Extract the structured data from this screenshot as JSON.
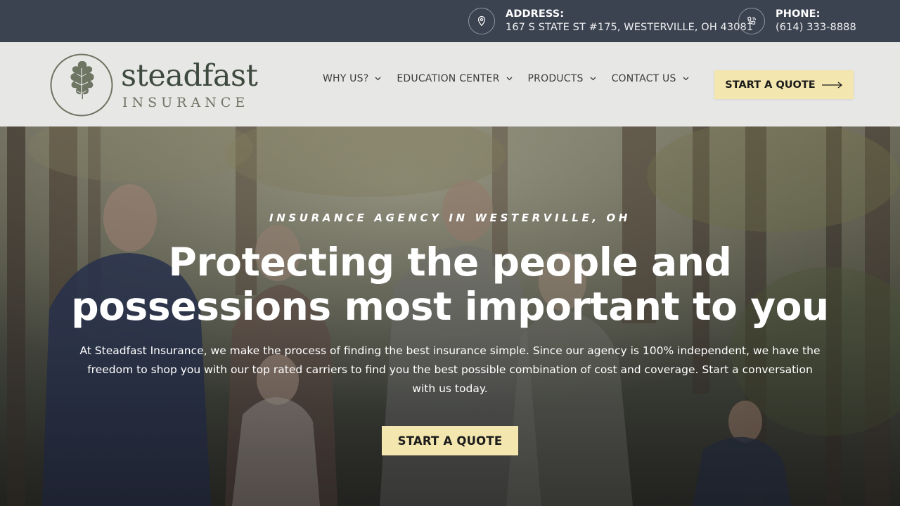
{
  "topbar": {
    "address": {
      "label": "ADDRESS:",
      "value": "167 S STATE ST #175, WESTERVILLE, OH 43081",
      "icon": "map-pin-icon"
    },
    "phone": {
      "label": "PHONE:",
      "value": "(614) 333-8888",
      "icon": "phone-icon"
    }
  },
  "logo": {
    "word": "steadfast",
    "sub": "INSURANCE",
    "icon": "oak-leaf-icon"
  },
  "nav": {
    "items": [
      {
        "label": "WHY US?"
      },
      {
        "label": "EDUCATION CENTER"
      },
      {
        "label": "PRODUCTS"
      },
      {
        "label": "CONTACT US"
      }
    ],
    "cta_label": "START A QUOTE"
  },
  "hero": {
    "eyebrow": "INSURANCE AGENCY IN WESTERVILLE, OH",
    "headline_line1": "Protecting the people and",
    "headline_line2": "possessions most important to you",
    "body": "At Steadfast Insurance, we make the process of finding the best insurance simple. Since our agency is 100% independent, we have the freedom to shop you with our top rated carriers to find you the best possible combination of cost and coverage. Start a conversation with us today.",
    "cta_label": "START A QUOTE"
  },
  "colors": {
    "topbar_bg": "#3c4350",
    "header_bg": "#e7e7e6",
    "accent": "#f3e6ae",
    "logo_green": "#6f7563"
  }
}
